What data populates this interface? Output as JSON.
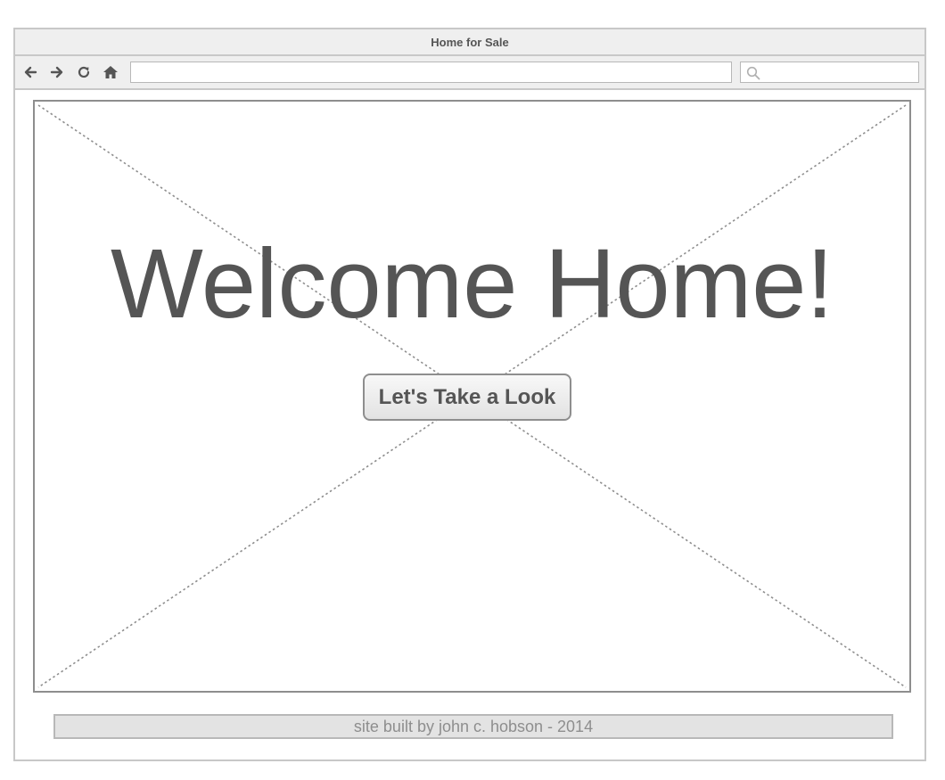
{
  "window": {
    "title": "Home for Sale"
  },
  "toolbar": {
    "back_icon": "arrow-left-icon",
    "forward_icon": "arrow-right-icon",
    "reload_icon": "reload-icon",
    "home_icon": "home-icon",
    "url_value": "",
    "search_icon": "search-icon",
    "search_value": ""
  },
  "hero": {
    "title": "Welcome Home!",
    "button_label": "Let's Take a Look",
    "image_placeholder": "image-placeholder"
  },
  "footer": {
    "text": "site built by john c. hobson - 2014"
  },
  "colors": {
    "chrome_bg": "#efefef",
    "chrome_border": "#c8c8c8",
    "text_dark": "#555555",
    "text_muted": "#8e8e8e",
    "footer_bg": "#e3e3e3"
  }
}
